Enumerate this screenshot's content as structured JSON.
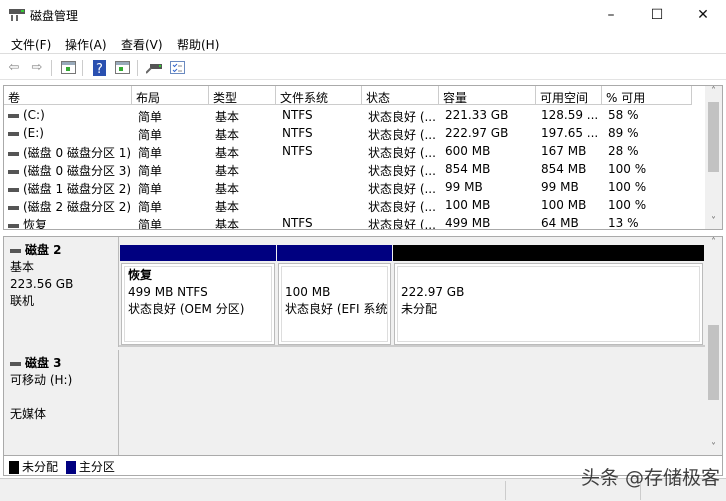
{
  "window": {
    "title": "磁盘管理",
    "minimize": "–",
    "maximize": "☐",
    "close": "✕"
  },
  "menu": [
    {
      "label": "文件(F)"
    },
    {
      "label": "操作(A)"
    },
    {
      "label": "查看(V)"
    },
    {
      "label": "帮助(H)"
    }
  ],
  "toolbar": {
    "icons": [
      "back-icon",
      "forward-icon",
      "show-hide-console-tree-icon",
      "help-icon",
      "show-hide-action-pane-icon",
      "connect-disk-icon",
      "properties-icon"
    ]
  },
  "table": {
    "columns": [
      "卷",
      "布局",
      "类型",
      "文件系统",
      "状态",
      "容量",
      "可用空间",
      "% 可用"
    ],
    "rows": [
      [
        "(C:)",
        "简单",
        "基本",
        "NTFS",
        "状态良好 (...",
        "221.33 GB",
        "128.59 ...",
        "58 %"
      ],
      [
        "(E:)",
        "简单",
        "基本",
        "NTFS",
        "状态良好 (...",
        "222.97 GB",
        "197.65 ...",
        "89 %"
      ],
      [
        "(磁盘 0 磁盘分区 1)",
        "简单",
        "基本",
        "NTFS",
        "状态良好 (...",
        "600 MB",
        "167 MB",
        "28 %"
      ],
      [
        "(磁盘 0 磁盘分区 3)",
        "简单",
        "基本",
        "",
        "状态良好 (...",
        "854 MB",
        "854 MB",
        "100 %"
      ],
      [
        "(磁盘 1 磁盘分区 2)",
        "简单",
        "基本",
        "",
        "状态良好 (...",
        "99 MB",
        "99 MB",
        "100 %"
      ],
      [
        "(磁盘 2 磁盘分区 2)",
        "简单",
        "基本",
        "",
        "状态良好 (...",
        "100 MB",
        "100 MB",
        "100 %"
      ],
      [
        "恢复",
        "简单",
        "基本",
        "NTFS",
        "状态良好 (...",
        "499 MB",
        "64 MB",
        "13 %"
      ]
    ]
  },
  "disks": [
    {
      "name": "磁盘 2",
      "type": "基本",
      "size": "223.56 GB",
      "status": "联机",
      "partitions": [
        {
          "title": "恢复",
          "line1": "499 MB NTFS",
          "line2": "状态良好 (OEM 分区)",
          "kind": "primary"
        },
        {
          "title": "",
          "line1": "100 MB",
          "line2": "状态良好 (EFI 系统",
          "kind": "primary"
        },
        {
          "title": "",
          "line1": "222.97 GB",
          "line2": "未分配",
          "kind": "unallocated"
        }
      ]
    },
    {
      "name": "磁盘 3",
      "type": "可移动 (H:)",
      "size": "",
      "status": "无媒体"
    }
  ],
  "legend": [
    {
      "label": "未分配",
      "color": "#000000"
    },
    {
      "label": "主分区",
      "color": "#000080"
    }
  ],
  "colors": {
    "primary": "#000080",
    "unallocated": "#000000"
  },
  "watermark": "头条 @存储极客"
}
